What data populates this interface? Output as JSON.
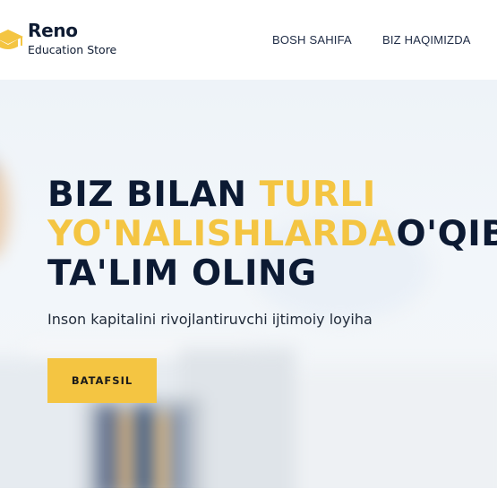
{
  "header": {
    "brand_name": "Reno",
    "brand_tagline": "Education Store",
    "nav": [
      {
        "label": "BOSH SAHIFA"
      },
      {
        "label": "BIZ HAQIMIZDA"
      }
    ]
  },
  "hero": {
    "title_line1_prefix": "BIZ BILAN ",
    "title_line1_highlight": "TURLI",
    "title_line2_highlight": "YO'NALISHLARDA",
    "title_line2_rest": "O'QIB",
    "title_line3": "TA'LIM OLING",
    "subtitle": "Inson kapitalini rivojlantiruvchi ijtimoiy loyiha",
    "cta_label": "BATAFSIL"
  },
  "colors": {
    "accent": "#f4c542",
    "heading": "#0c1a33",
    "text": "#222c3b"
  },
  "icons": {
    "logo": "graduation-cap-icon"
  }
}
